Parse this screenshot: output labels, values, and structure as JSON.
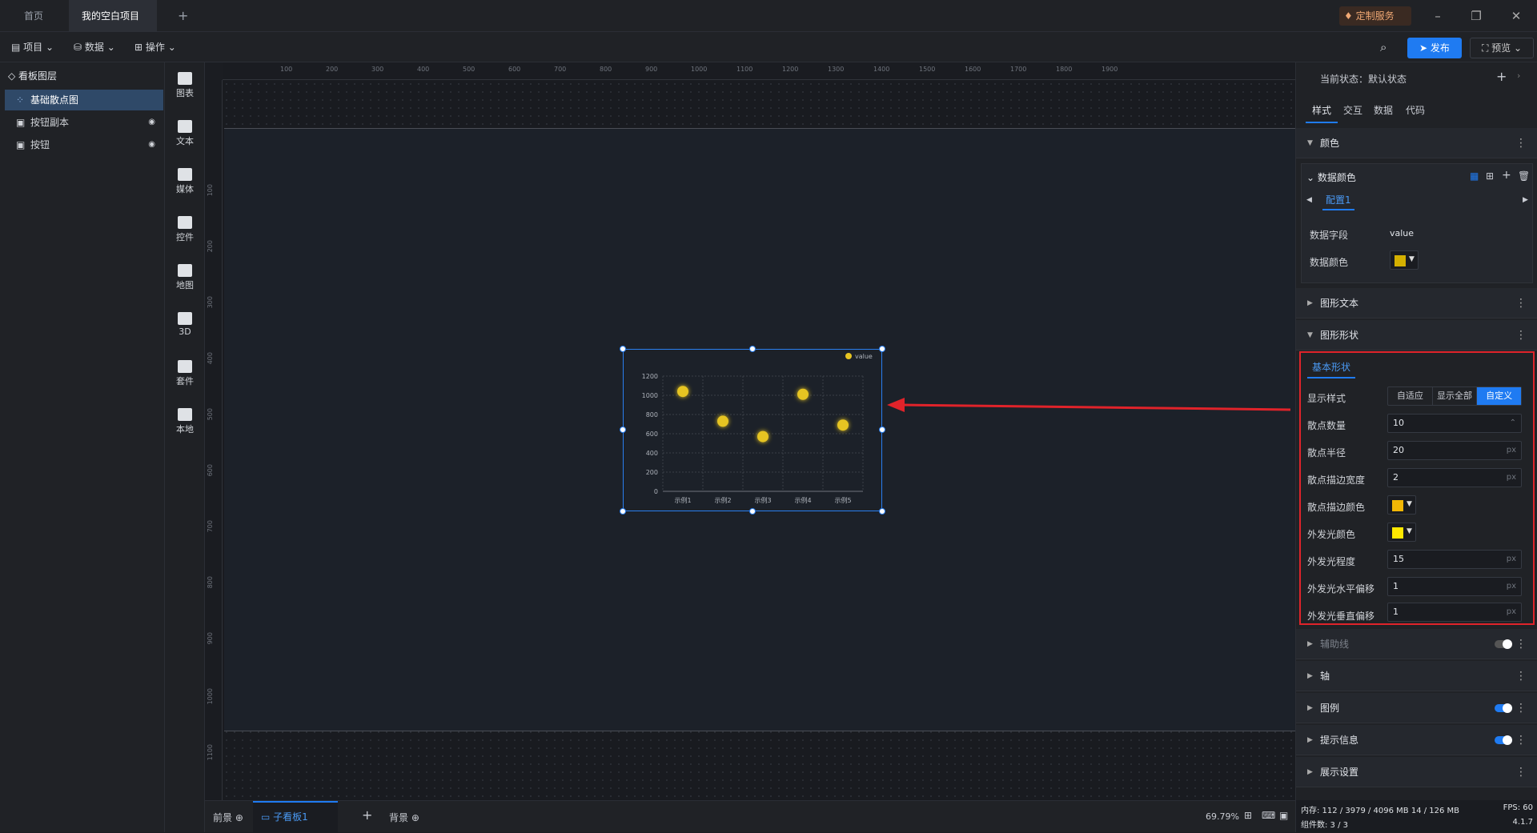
{
  "tabs": [
    {
      "label": "首页"
    },
    {
      "label": "我的空白项目"
    }
  ],
  "title_actions": {
    "custom_service": "定制服务"
  },
  "toolbar": {
    "project": "项目",
    "data": "数据",
    "operate": "操作",
    "publish": "发布",
    "preview": "预览"
  },
  "layers": {
    "title": "看板图层",
    "items": [
      {
        "label": "基础散点图"
      },
      {
        "label": "按钮副本"
      },
      {
        "label": "按钮"
      }
    ]
  },
  "iconbar": [
    {
      "label": "图表"
    },
    {
      "label": "文本"
    },
    {
      "label": "媒体"
    },
    {
      "label": "控件"
    },
    {
      "label": "地图"
    },
    {
      "label": "3D"
    },
    {
      "label": "套件"
    },
    {
      "label": "本地"
    }
  ],
  "ruler": {
    "top": [
      "100",
      "200",
      "300",
      "400",
      "500",
      "600",
      "700",
      "800",
      "900",
      "1000",
      "1100",
      "1200",
      "1300",
      "1400",
      "1500",
      "1600",
      "1700",
      "1800",
      "1900"
    ],
    "left": [
      "100",
      "200",
      "300",
      "400",
      "500",
      "600",
      "700",
      "800",
      "900",
      "1000",
      "1100"
    ]
  },
  "chart_data": {
    "type": "scatter",
    "categories": [
      "示例1",
      "示例2",
      "示例3",
      "示例4",
      "示例5"
    ],
    "series": [
      {
        "name": "value",
        "values": [
          1040,
          730,
          570,
          1010,
          690
        ]
      }
    ],
    "ylim": [
      0,
      1200
    ],
    "yticks": [
      "0",
      "200",
      "400",
      "600",
      "800",
      "1000",
      "1200"
    ],
    "legend": "top-right",
    "point_color": "#e6c422"
  },
  "bottom": {
    "foreground": "前景",
    "sub_board": "子看板1",
    "background": "背景",
    "zoom": "69.79%"
  },
  "right": {
    "state": "当前状态：默认状态",
    "tabs": [
      "样式",
      "交互",
      "数据",
      "代码"
    ],
    "sections": {
      "color": "颜色",
      "data_color": "数据颜色",
      "config": "配置1",
      "data_field_label": "数据字段",
      "data_field_value": "value",
      "data_color_label": "数据颜色",
      "shape_text": "图形文本",
      "shape": "图形形状",
      "basic_shape": "基本形状",
      "auxline": "辅助线",
      "axis": "轴",
      "legend": "图例",
      "tooltip": "提示信息",
      "display": "展示设置"
    },
    "shape_fields": {
      "display_style": {
        "label": "显示样式",
        "options": [
          "自适应",
          "显示全部",
          "自定义"
        ],
        "selected": "自定义"
      },
      "count": {
        "label": "散点数量",
        "value": "10"
      },
      "radius": {
        "label": "散点半径",
        "value": "20",
        "unit": "px"
      },
      "border_width": {
        "label": "散点描边宽度",
        "value": "2",
        "unit": "px"
      },
      "border_color": {
        "label": "散点描边颜色",
        "color": "#f2b705"
      },
      "glow_color": {
        "label": "外发光颜色",
        "color": "#ffe800"
      },
      "glow_level": {
        "label": "外发光程度",
        "value": "15",
        "unit": "px"
      },
      "glow_x": {
        "label": "外发光水平偏移",
        "value": "1",
        "unit": "px"
      },
      "glow_y": {
        "label": "外发光垂直偏移",
        "value": "1",
        "unit": "px"
      }
    },
    "data_color_swatch": "#d4b000",
    "status": {
      "memory": "内存: 112 / 3979 / 4096 MB 14 / 126 MB",
      "fps": "FPS: 60",
      "components": "组件数: 3 / 3",
      "version": "4.1.7"
    }
  }
}
